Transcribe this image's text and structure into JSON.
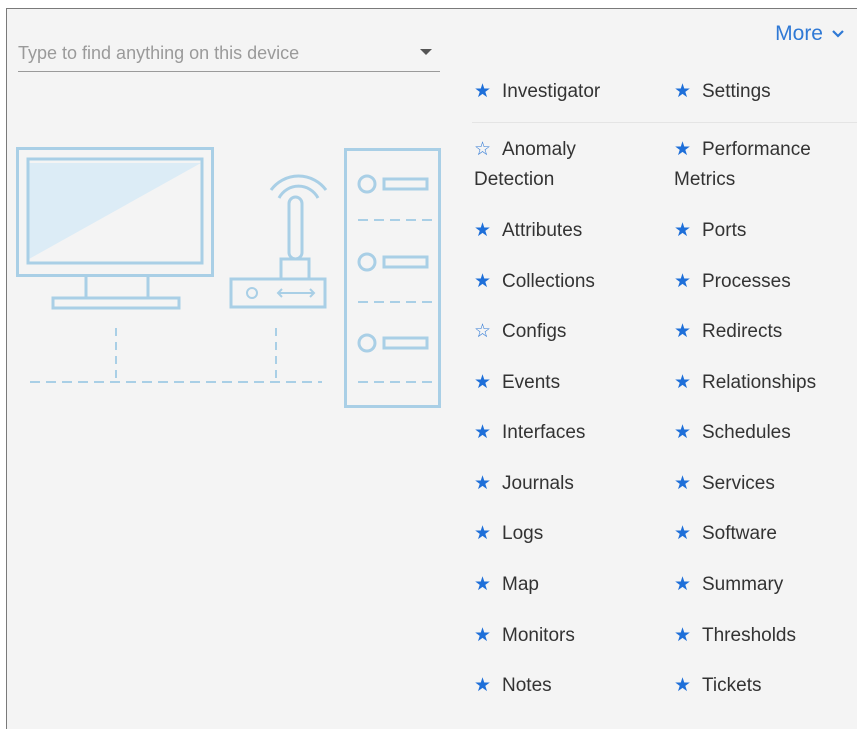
{
  "search": {
    "placeholder": "Type to find anything on this device"
  },
  "more": {
    "label": "More"
  },
  "icons": {
    "filled_star": "star-filled-icon",
    "hollow_star": "star-outline-icon",
    "more_chevron": "chevron-down-icon",
    "dropdown": "caret-down-icon"
  },
  "colors": {
    "accent": "#2f79d5",
    "star": "#1e6fd9",
    "illustration": "#a9cfe6",
    "panel_bg": "#f4f4f4"
  },
  "pinned": [
    {
      "label": "Investigator",
      "starred": true
    },
    {
      "label": "Settings",
      "starred": true
    }
  ],
  "left_column": [
    {
      "label": "Anomaly Detection",
      "line1": "Anomaly",
      "line2": "Detection",
      "starred": false
    },
    {
      "label": "Attributes",
      "starred": true
    },
    {
      "label": "Collections",
      "starred": true
    },
    {
      "label": "Configs",
      "starred": false
    },
    {
      "label": "Events",
      "starred": true
    },
    {
      "label": "Interfaces",
      "starred": true
    },
    {
      "label": "Journals",
      "starred": true
    },
    {
      "label": "Logs",
      "starred": true
    },
    {
      "label": "Map",
      "starred": true
    },
    {
      "label": "Monitors",
      "starred": true
    },
    {
      "label": "Notes",
      "starred": true
    }
  ],
  "right_column": [
    {
      "label": "Performance Metrics",
      "line1": "Performance",
      "line2": "Metrics",
      "starred": true
    },
    {
      "label": "Ports",
      "starred": true
    },
    {
      "label": "Processes",
      "starred": true
    },
    {
      "label": "Redirects",
      "starred": true
    },
    {
      "label": "Relationships",
      "starred": true
    },
    {
      "label": "Schedules",
      "starred": true
    },
    {
      "label": "Services",
      "starred": true
    },
    {
      "label": "Software",
      "starred": true
    },
    {
      "label": "Summary",
      "starred": true
    },
    {
      "label": "Thresholds",
      "starred": true
    },
    {
      "label": "Tickets",
      "starred": true
    }
  ]
}
